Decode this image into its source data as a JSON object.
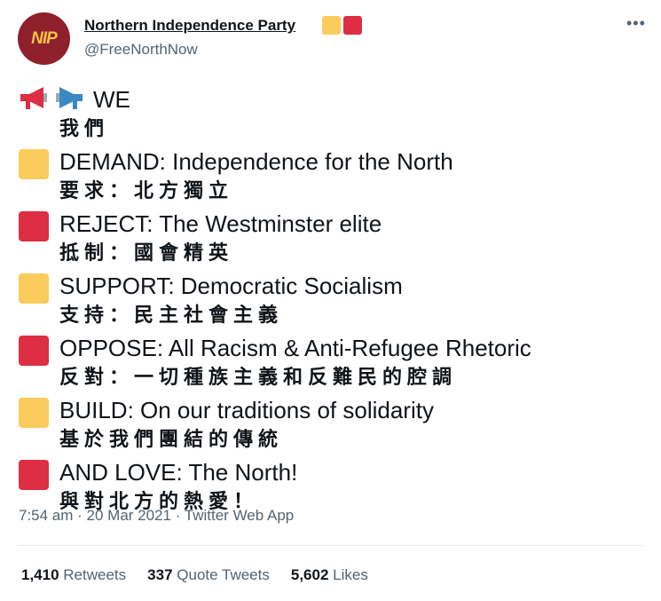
{
  "account": {
    "avatar_text": "NIP",
    "display_name": "Northern Independence Party",
    "handle": "@FreeNorthNow"
  },
  "colors": {
    "yellow": "#fbcc5c",
    "red": "#dd2e44",
    "avatar_bg": "#8f1f2b",
    "megaphone_red": "#dd2e44",
    "megaphone_blue": "#3b88c3"
  },
  "tweet": {
    "intro": {
      "en": "WE",
      "zh": "我們"
    },
    "lines": [
      {
        "color": "yellow",
        "en": "DEMAND: Independence for the North",
        "zh": "要求：北方獨立"
      },
      {
        "color": "red",
        "en": "REJECT: The Westminster elite",
        "zh": "抵制：國會精英"
      },
      {
        "color": "yellow",
        "en": "SUPPORT: Democratic Socialism",
        "zh": "支持：民主社會主義"
      },
      {
        "color": "red",
        "en": "OPPOSE: All Racism & Anti-Refugee Rhetoric",
        "zh": "反對：一切種族主義和反難民的腔調"
      },
      {
        "color": "yellow",
        "en": "BUILD: On our traditions of solidarity",
        "zh": "基於我們團結的傳統"
      },
      {
        "color": "red",
        "en": "AND LOVE: The North!",
        "zh": "與對北方的熱愛！"
      }
    ]
  },
  "meta": {
    "timestamp": "7:54 am · 20 Mar 2021 · Twitter Web App"
  },
  "stats": {
    "retweets_count": "1,410",
    "retweets_label": "Retweets",
    "quotes_count": "337",
    "quotes_label": "Quote Tweets",
    "likes_count": "5,602",
    "likes_label": "Likes"
  },
  "icons": {
    "more": "more-icon",
    "megaphone": "megaphone-icon"
  }
}
